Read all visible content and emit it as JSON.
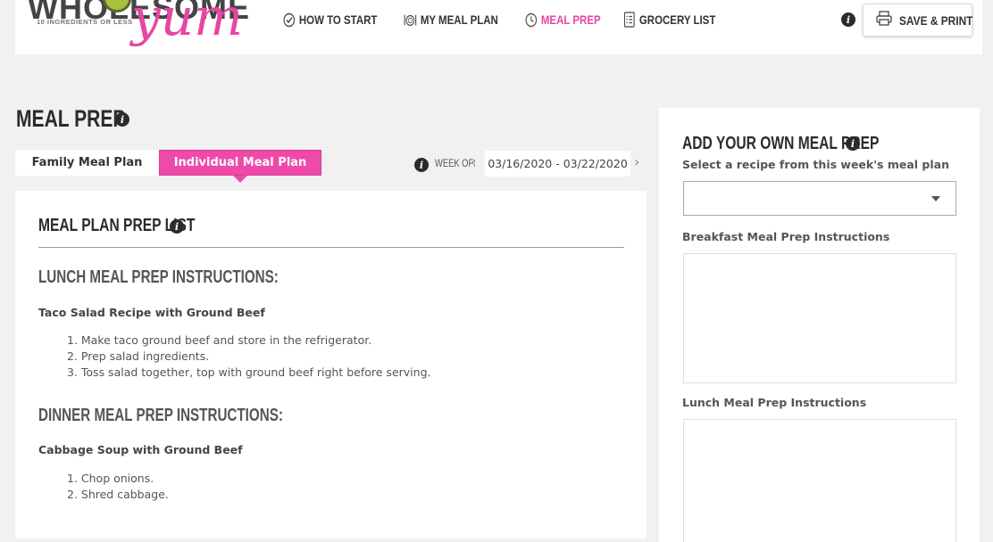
{
  "header": {
    "logo": {
      "brand": "WHOLESOME",
      "script": "yum",
      "tagline": "10 INGREDIENTS OR LESS"
    },
    "nav": [
      {
        "label": "HOW TO START",
        "icon": "check-circle-icon",
        "active": false
      },
      {
        "label": "MY MEAL PLAN",
        "icon": "plate-cutlery-icon",
        "active": false
      },
      {
        "label": "MEAL PREP",
        "icon": "clock-icon",
        "active": true
      },
      {
        "label": "GROCERY LIST",
        "icon": "checklist-icon",
        "active": false
      }
    ],
    "save_label": "SAVE & PRINT",
    "accent_color": "#e646a4"
  },
  "page": {
    "title": "MEAL PREP",
    "tabs": [
      {
        "label": "Family Meal Plan",
        "active": false
      },
      {
        "label": "Individual Meal Plan",
        "active": true
      }
    ],
    "week": {
      "label": "WEEK OF:",
      "range": "03/16/2020 - 03/22/2020"
    }
  },
  "prep_list": {
    "heading": "MEAL PLAN PREP LIST",
    "sections": [
      {
        "heading": "LUNCH MEAL PREP INSTRUCTIONS:",
        "recipe": "Taco Salad Recipe with Ground Beef",
        "steps": [
          "1. Make taco ground beef and store in the refrigerator.",
          "2. Prep salad ingredients.",
          "3. Toss salad together, top with ground beef right before serving."
        ]
      },
      {
        "heading": "DINNER MEAL PREP INSTRUCTIONS:",
        "recipe": "Cabbage Soup with Ground Beef",
        "steps": [
          "1. Chop onions.",
          "2. Shred cabbage."
        ]
      }
    ]
  },
  "add_own": {
    "heading": "ADD YOUR OWN MEAL PREP",
    "select_label": "Select a recipe from this week's meal plan",
    "select_value": "",
    "breakfast_label": "Breakfast Meal Prep Instructions",
    "lunch_label": "Lunch Meal Prep Instructions"
  }
}
